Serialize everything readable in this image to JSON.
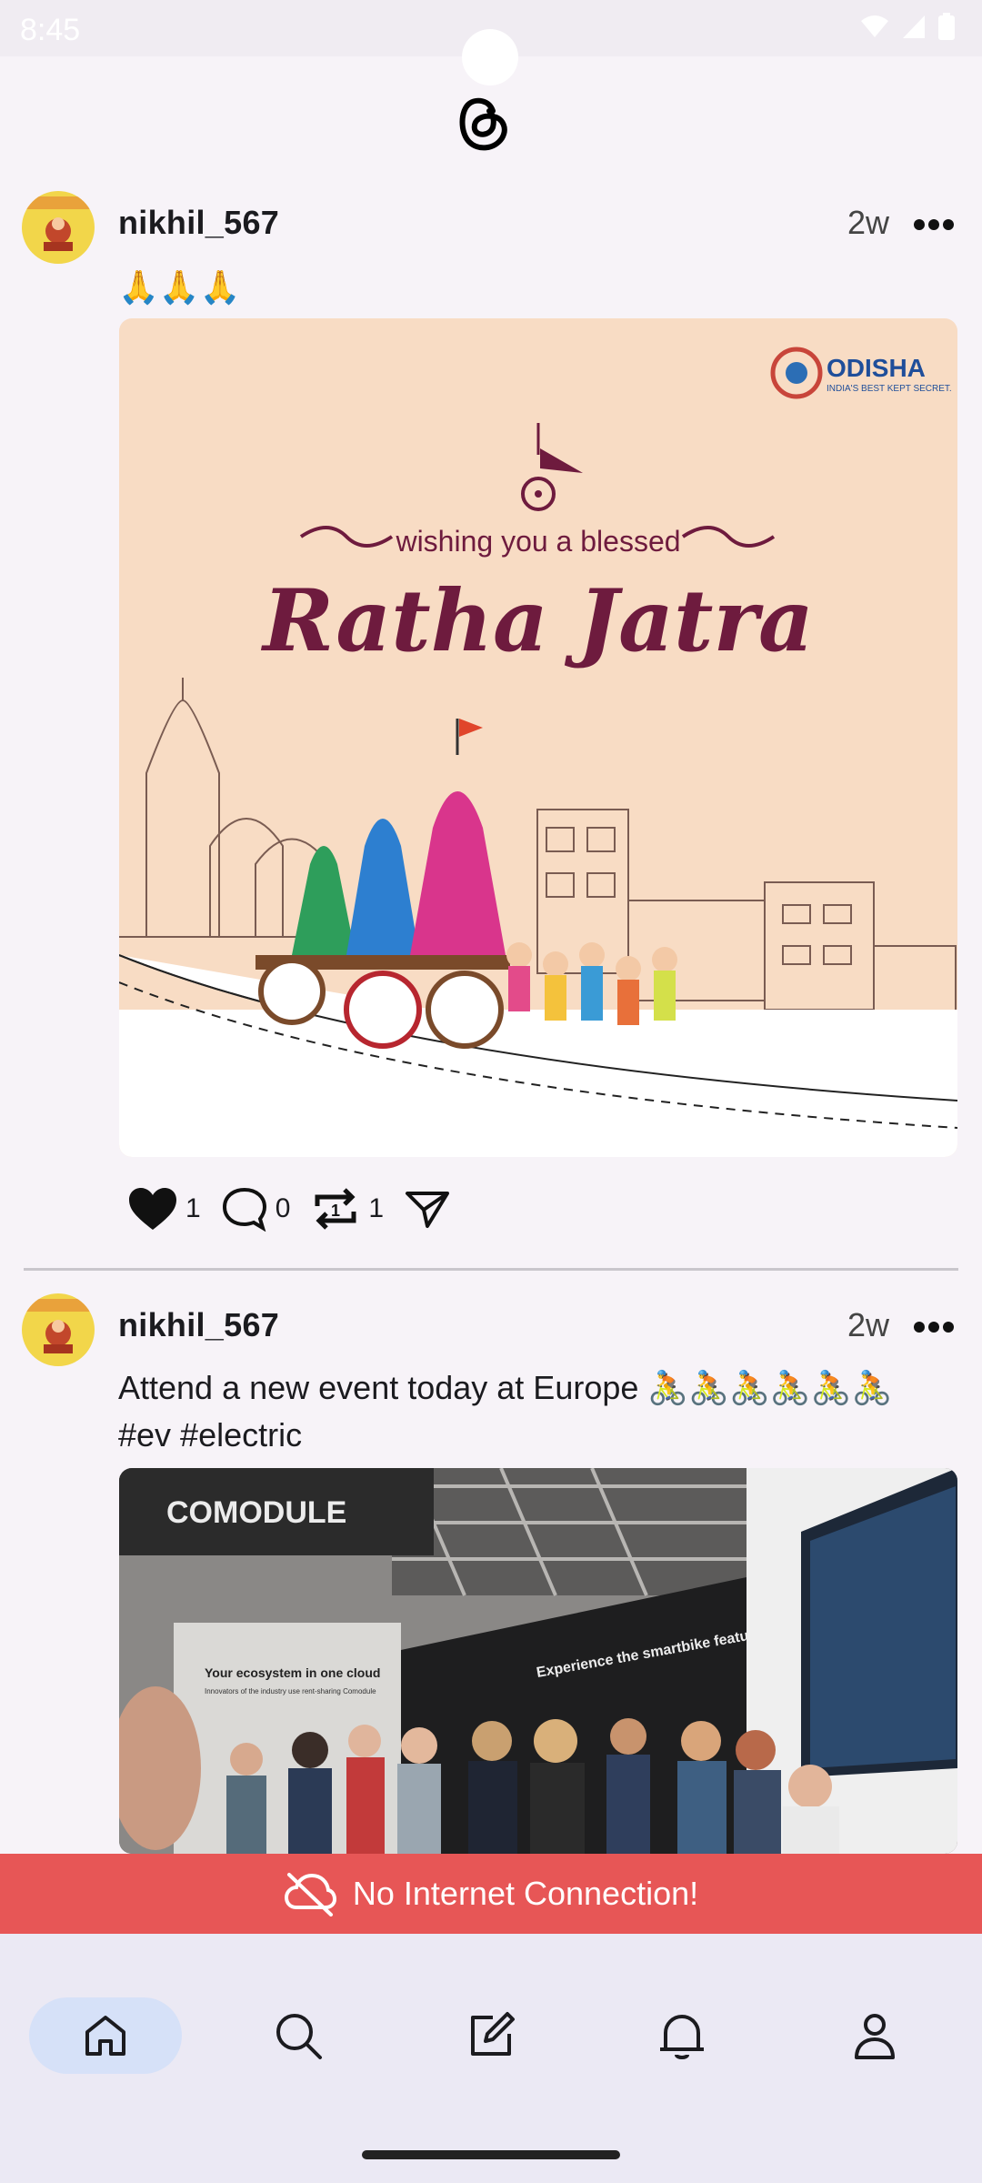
{
  "status_bar": {
    "time": "8:45"
  },
  "posts": [
    {
      "username": "nikhil_567",
      "time": "2w",
      "caption": "🙏🙏🙏",
      "image": {
        "logo_title": "ODISHA",
        "logo_tagline": "INDIA'S BEST KEPT SECRET.",
        "greeting": "wishing you a blessed",
        "title": "Ratha Jatra"
      },
      "actions": {
        "likes": "1",
        "replies": "0",
        "reposts": "1"
      }
    },
    {
      "username": "nikhil_567",
      "time": "2w",
      "caption_line1": "Attend a new event today at Europe 🚴🚴🚴🚴🚴🚴",
      "caption_line2": "#ev #electric",
      "image": {
        "brand": "COMODULE",
        "wall_text": "Your ecosystem in one cloud",
        "wall_sub": "Innovators of the industry use rent-sharing Comodule",
        "booth_text": "Experience the smartbike features"
      }
    }
  ],
  "banner": {
    "text": "No Internet Connection!"
  },
  "nav": {
    "items": [
      "home",
      "search",
      "compose",
      "notifications",
      "profile"
    ],
    "active": "home"
  },
  "colors": {
    "banner": "#E75656",
    "nav_active": "#D6E1F8",
    "poster_bg": "#F8DCC4",
    "poster_text": "#6E1B3E"
  }
}
